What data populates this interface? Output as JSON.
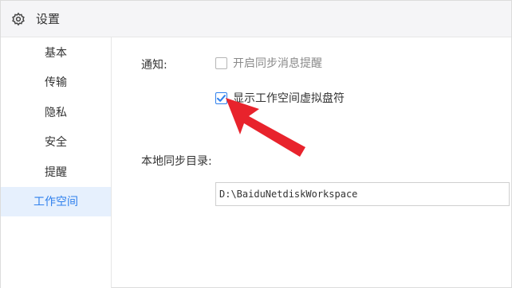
{
  "window": {
    "title": "设置",
    "title_icon": "gear-icon"
  },
  "sidebar": {
    "items": [
      {
        "label": "基本",
        "active": false
      },
      {
        "label": "传输",
        "active": false
      },
      {
        "label": "隐私",
        "active": false
      },
      {
        "label": "安全",
        "active": false
      },
      {
        "label": "提醒",
        "active": false
      },
      {
        "label": "工作空间",
        "active": true
      }
    ]
  },
  "settings": {
    "notify_label": "通知:",
    "options": [
      {
        "label": "开启同步消息提醒",
        "checked": false
      },
      {
        "label": "显示工作空间虚拟盘符",
        "checked": true
      }
    ],
    "local_dir_label": "本地同步目录:",
    "local_dir_value": "D:\\BaiduNetdiskWorkspace"
  },
  "annotation": {
    "arrow_color": "#e8232c",
    "arrow_icon": "red-arrow-icon"
  },
  "colors": {
    "accent": "#2f80ed",
    "active_bg": "#e6f0fd"
  }
}
